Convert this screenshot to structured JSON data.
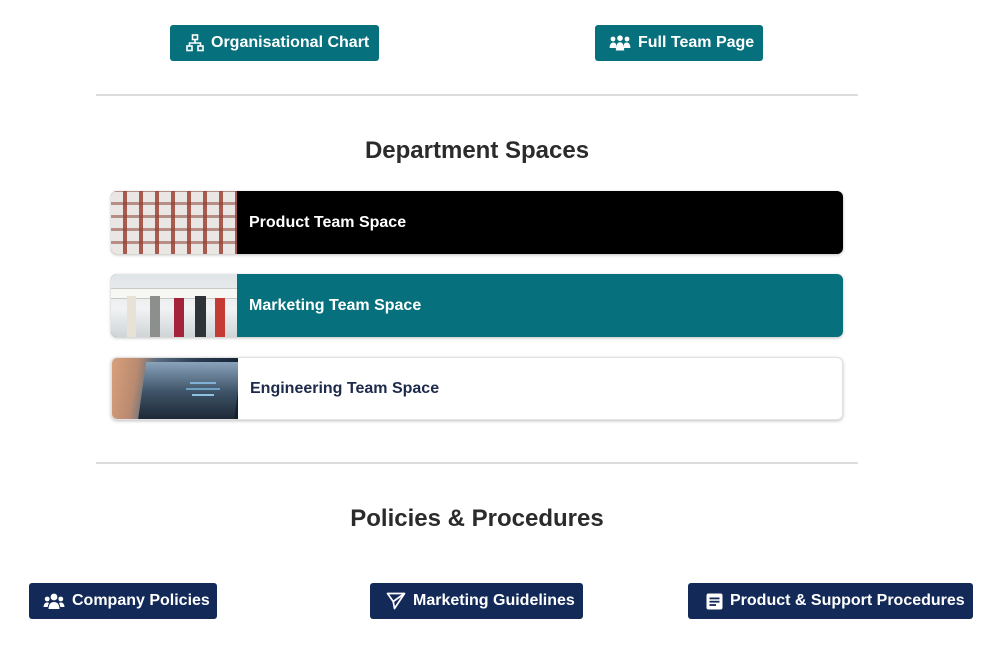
{
  "top_links": {
    "org_chart": {
      "label": "Organisational Chart",
      "icon": "org-chart-icon"
    },
    "full_team": {
      "label": "Full Team Page",
      "icon": "people-group-icon"
    }
  },
  "department_spaces": {
    "title": "Department Spaces",
    "cards": [
      {
        "label": "Product Team Space",
        "image": "sticky-notes-wall-photo",
        "bg": "#000000"
      },
      {
        "label": "Marketing Team Space",
        "image": "marketing-team-photo",
        "bg": "#07707d"
      },
      {
        "label": "Engineering Team Space",
        "image": "laptop-code-photo",
        "bg": "#ffffff"
      }
    ]
  },
  "policies": {
    "title": "Policies & Procedures",
    "buttons": [
      {
        "label": "Company Policies",
        "icon": "users-icon"
      },
      {
        "label": "Marketing Guidelines",
        "icon": "paper-plane-icon"
      },
      {
        "label": "Product & Support Procedures",
        "icon": "document-icon"
      }
    ]
  },
  "colors": {
    "teal": "#07707d",
    "navy": "#132a58",
    "divider": "#dcdcdc"
  }
}
